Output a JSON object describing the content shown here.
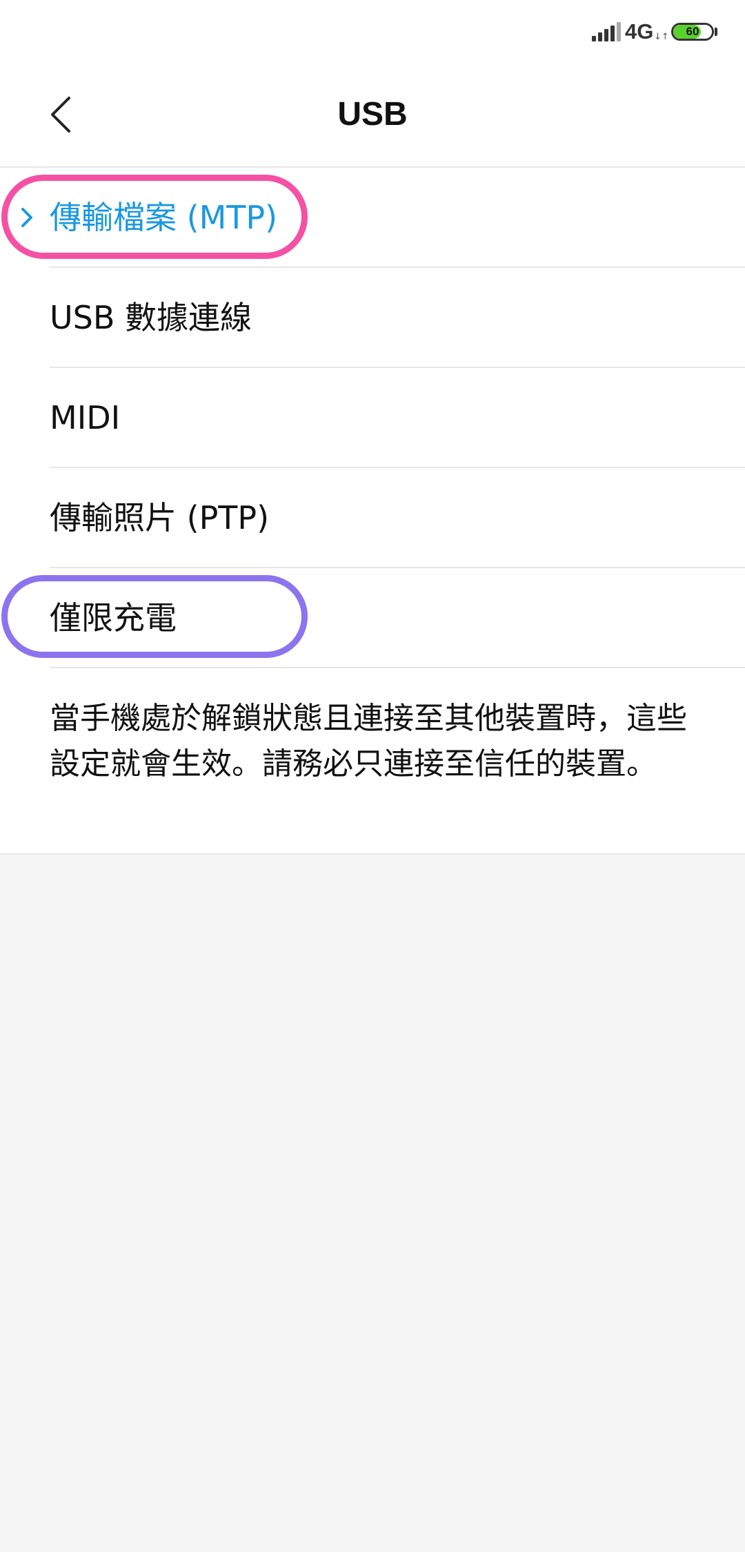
{
  "status_bar": {
    "network": "4G",
    "network_activity": "↓↑",
    "battery_level": "60",
    "battery_fraction": 0.72,
    "signal_icon": "cell-signal-icon",
    "battery_icon": "battery-icon"
  },
  "header": {
    "title": "USB",
    "back_icon": "back-arrow-icon"
  },
  "options": [
    {
      "label": "傳輸檔案 (MTP)",
      "selected": true
    },
    {
      "label": "USB 數據連線",
      "selected": false
    },
    {
      "label": "MIDI",
      "selected": false
    },
    {
      "label": "傳輸照片 (PTP)",
      "selected": false
    },
    {
      "label": "僅限充電",
      "selected": false
    }
  ],
  "description": "當手機處於解鎖狀態且連接至其他裝置時，這些設定就會生效。請務必只連接至信任的裝置。",
  "colors": {
    "accent": "#1a98e0",
    "annotation_pink": "#f551a4",
    "annotation_purple": "#8b74ee",
    "page_background": "#f5f5f5",
    "battery_green": "#5bd12d"
  }
}
